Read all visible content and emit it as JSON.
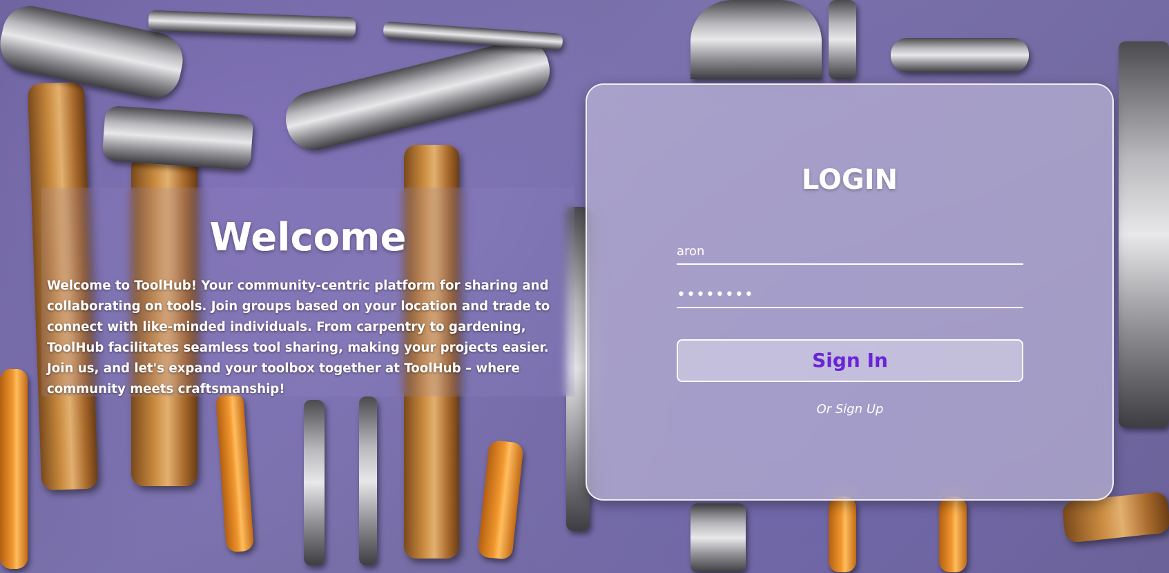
{
  "welcome": {
    "title": "Welcome",
    "text": "Welcome to ToolHub! Your community-centric platform for sharing and collaborating on tools. Join groups based on your location and trade to connect with like-minded individuals. From carpentry to gardening, ToolHub facilitates seamless tool sharing, making your projects easier. Join us, and let's expand your toolbox together at ToolHub – where community meets craftsmanship!"
  },
  "login": {
    "title": "LOGIN",
    "username_value": "aron",
    "password_value": "••••••••",
    "signin_label": "Sign In",
    "signup_label": "Or Sign Up"
  },
  "colors": {
    "accent": "#6a24d6",
    "background": "#6f669f"
  },
  "background_image": "tools-background"
}
